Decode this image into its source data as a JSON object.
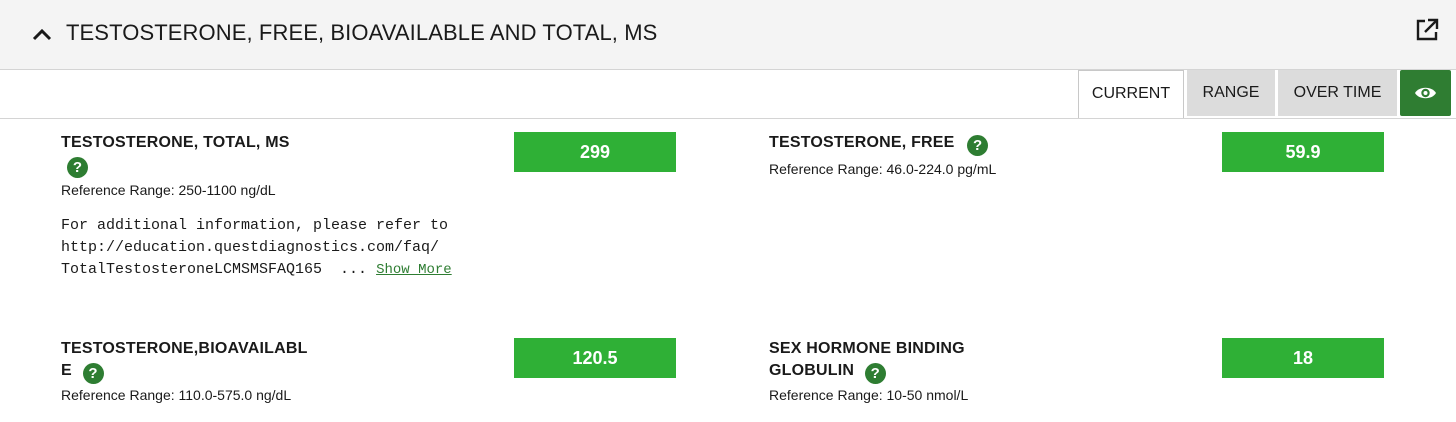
{
  "panel": {
    "title": "TESTOSTERONE, FREE, BIOAVAILABLE AND TOTAL, MS"
  },
  "tabs": [
    {
      "label": "CURRENT"
    },
    {
      "label": "RANGE"
    },
    {
      "label": "OVER TIME"
    }
  ],
  "results": [
    {
      "name_line1": "TESTOSTERONE, TOTAL, MS",
      "help": "?",
      "reference": "Reference Range: 250-1100 ng/dL",
      "value": "299",
      "note_line1": "For additional information, please refer to",
      "note_line2": "http://education.questdiagnostics.com/faq/",
      "note_line3": "TotalTestosteroneLCMSMSFAQ165  ... ",
      "show_more": "Show More"
    },
    {
      "name_line1": "TESTOSTERONE, FREE",
      "help": "?",
      "reference": "Reference Range: 46.0-224.0 pg/mL",
      "value": "59.9"
    },
    {
      "name_line1": "TESTOSTERONE,BIOAVAILABL",
      "name_line2": "E",
      "help": "?",
      "reference": "Reference Range: 110.0-575.0 ng/dL",
      "value": "120.5"
    },
    {
      "name_line1": "SEX HORMONE BINDING",
      "name_line2": "GLOBULIN",
      "help": "?",
      "reference": "Reference Range: 10-50 nmol/L",
      "value": "18"
    }
  ],
  "icons": {
    "collapse": "chevron-up-icon",
    "external": "external-link-icon",
    "view": "eye-icon"
  },
  "colors": {
    "value_bg": "#2fb036",
    "help_bg": "#2e7d32",
    "eye_button_bg": "#2f7d32",
    "header_bg": "#f4f4f4"
  }
}
